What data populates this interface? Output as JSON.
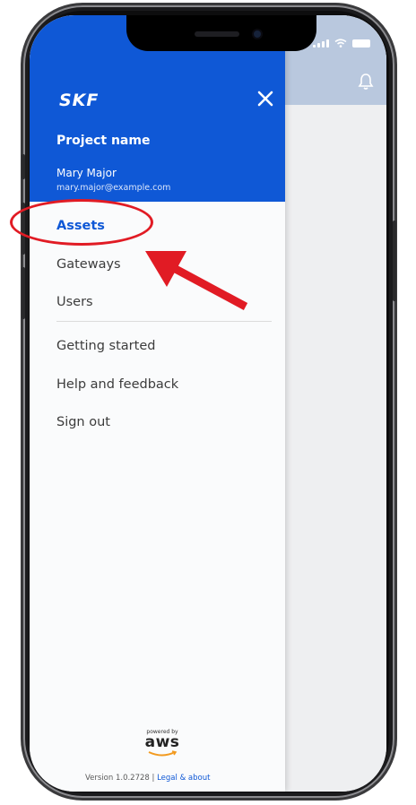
{
  "drawer": {
    "brand": "SKF",
    "project_name": "Project name",
    "user_name": "Mary Major",
    "user_email": "mary.major@example.com",
    "nav_items": [
      {
        "label": "Assets",
        "active": true
      },
      {
        "label": "Gateways"
      },
      {
        "label": "Users"
      }
    ],
    "secondary_items": [
      {
        "label": "Getting started"
      },
      {
        "label": "Help and feedback"
      },
      {
        "label": "Sign out"
      }
    ],
    "footer": {
      "powered_by": "powered by",
      "aws": "aws",
      "version": "Version 1.0.2728 |",
      "legal_link": "Legal & about"
    }
  },
  "icons": [
    "close-icon",
    "bell-icon",
    "signal-icon",
    "wifi-icon",
    "battery-icon",
    "aws-logo"
  ],
  "colors": {
    "brand_blue": "#0f58d6",
    "header_light": "#b9c8de",
    "annotation_red": "#e11b24"
  }
}
